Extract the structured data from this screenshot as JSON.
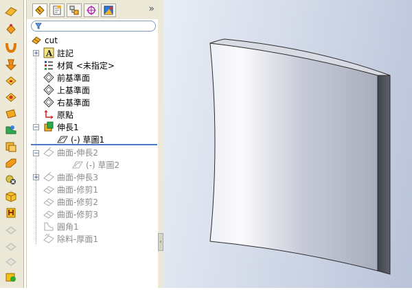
{
  "panel": {
    "more_label": "»",
    "tabs": [
      "feature-manager-tab",
      "property-manager-tab",
      "configuration-manager-tab",
      "dimxpert-tab",
      "display-manager-tab"
    ]
  },
  "tree": {
    "root": "cut",
    "items": [
      {
        "label": "註記",
        "state": "normal"
      },
      {
        "label": "材質 <未指定>",
        "state": "normal"
      },
      {
        "label": "前基準面",
        "state": "normal"
      },
      {
        "label": "上基準面",
        "state": "normal"
      },
      {
        "label": "右基準面",
        "state": "normal"
      },
      {
        "label": "原點",
        "state": "normal"
      },
      {
        "label": "伸長1",
        "state": "normal"
      },
      {
        "label": "(-) 草圖1",
        "state": "normal"
      },
      {
        "label": "曲面-伸長2",
        "state": "suppressed"
      },
      {
        "label": "(-) 草圖2",
        "state": "suppressed"
      },
      {
        "label": "曲面-伸長3",
        "state": "suppressed"
      },
      {
        "label": "曲面-修剪1",
        "state": "suppressed"
      },
      {
        "label": "曲面-修剪2",
        "state": "suppressed"
      },
      {
        "label": "曲面-修剪3",
        "state": "suppressed"
      },
      {
        "label": "圓角1",
        "state": "suppressed"
      },
      {
        "label": "除料-厚面1",
        "state": "suppressed"
      }
    ]
  },
  "colors": {
    "rollback_bar": "#4a78c4",
    "suppressed_text": "#8c8c8c",
    "part_face_light": "#f4f5f9",
    "part_face_dark": "#53575f"
  }
}
